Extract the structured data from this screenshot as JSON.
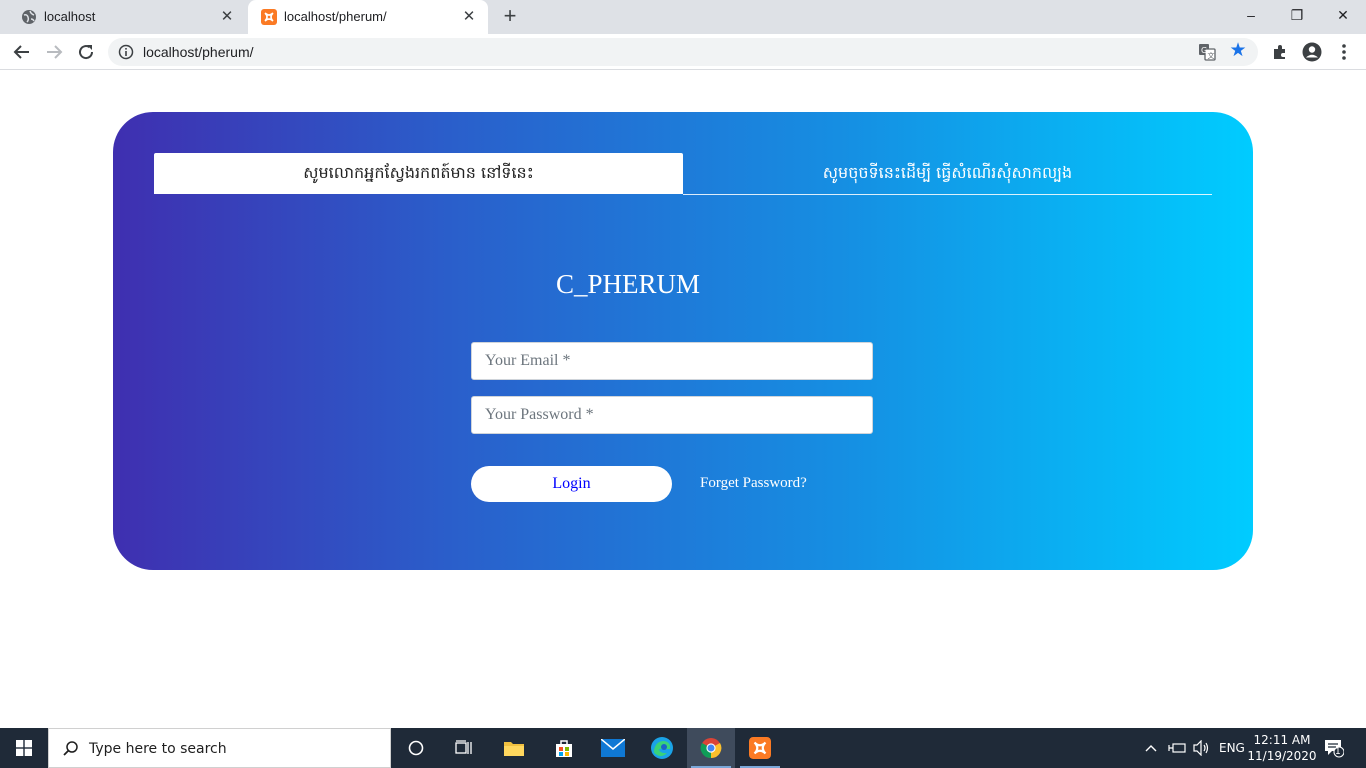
{
  "browser": {
    "tabs": [
      {
        "title": "localhost",
        "icon": "globe-icon"
      },
      {
        "title": "localhost/pherum/",
        "icon": "xampp-icon"
      }
    ],
    "new_tab_label": "+",
    "url": "localhost/pherum/",
    "window_controls": {
      "minimize": "–",
      "restore": "❐",
      "close": "✕"
    }
  },
  "page": {
    "tabs": [
      {
        "label": "សូមលោកអ្នកស្វែងរកពត៍មាន នៅទីនេះ",
        "active": true
      },
      {
        "label": "សូមចុចទីនេះដើម្បី ធ្វើសំណើរសុំសាកល្បង",
        "active": false
      }
    ],
    "brand": "C_PHERUM",
    "email_placeholder": "Your Email *",
    "password_placeholder": "Your Password *",
    "login_label": "Login",
    "forget_label": "Forget Password?",
    "colors": {
      "gradient_start": "#3f2fb0",
      "gradient_end": "#00ccff",
      "login_text": "#0000ff"
    }
  },
  "taskbar": {
    "search_placeholder": "Type here to search",
    "language": "ENG",
    "time": "12:11 AM",
    "date": "11/19/2020",
    "notification_count": "1"
  }
}
